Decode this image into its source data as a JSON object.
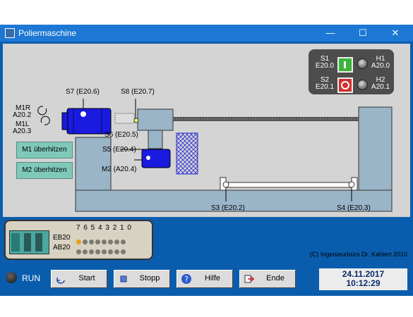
{
  "window": {
    "title": "Poliermaschine",
    "minimize": "—",
    "maximize": "☐",
    "close": "✕"
  },
  "motor1": {
    "direction_right_label": "M1R",
    "direction_right_addr": "A20.2",
    "direction_left_label": "M1L",
    "direction_left_addr": "A20.3"
  },
  "sensors": {
    "s7": "S7 (E20.6)",
    "s8": "S8 (E20.7)",
    "s6": "S6 (E20.5)",
    "s5": "S5 (E20.4)",
    "m2": "M2 (A20.4)",
    "s3": "S3 (E20.2)",
    "s4": "S4 (E20.3)"
  },
  "buttons": {
    "m1_overheat": "M1 überhitzen",
    "m2_overheat": "M2 überhitzen"
  },
  "control_panel": {
    "s1_label": "S1",
    "s1_addr": "E20.0",
    "s2_label": "S2",
    "s2_addr": "E20.1",
    "h1_label": "H1",
    "h1_addr": "A20.0",
    "h2_label": "H2",
    "h2_addr": "A20.1"
  },
  "plc": {
    "bit_header": "7 6 5 4 3 2 1 0",
    "eb_label": "EB20",
    "ab_label": "AB20",
    "eb20_bits": [
      1,
      0,
      0,
      0,
      0,
      0,
      0,
      0
    ],
    "ab20_bits": [
      0,
      0,
      0,
      0,
      0,
      0,
      0,
      0
    ]
  },
  "copyright": "(C) Ingenieurbüro Dr. Kahlert 2010",
  "status": {
    "run_label": "RUN"
  },
  "toolbar": {
    "start": "Start",
    "stop": "Stopp",
    "help": "Hilfe",
    "end": "Ende"
  },
  "clock": {
    "date": "24.11.2017",
    "time": "10:12:29"
  },
  "colors": {
    "machine_fill": "#9ab4c8",
    "motor_blue": "#1a1ae0",
    "panel_bg": "#d4d4d4",
    "frame_blue": "#0a5dad",
    "led_on": "#e8a020"
  }
}
